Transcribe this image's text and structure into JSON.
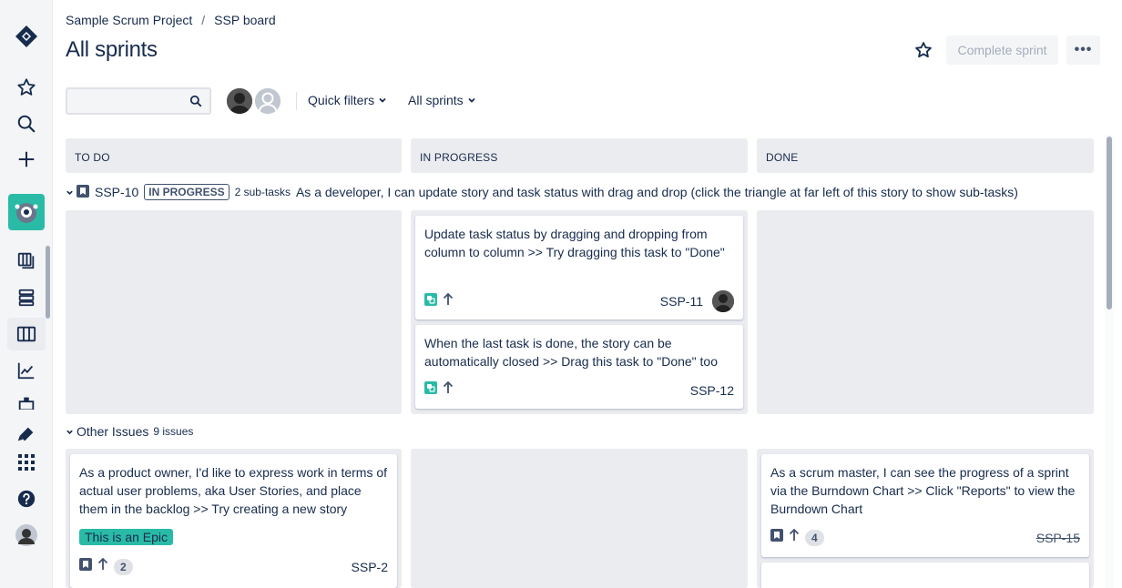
{
  "breadcrumb": {
    "project": "Sample Scrum Project",
    "separator": "/",
    "board": "SSP board"
  },
  "page": {
    "title": "All sprints"
  },
  "header": {
    "complete_sprint": "Complete sprint",
    "more": "•••"
  },
  "search": {
    "value": "",
    "placeholder": ""
  },
  "filters": {
    "quick_filters": "Quick filters",
    "all_sprints": "All sprints"
  },
  "columns": [
    "TO DO",
    "IN PROGRESS",
    "DONE"
  ],
  "lanes": {
    "story": {
      "key": "SSP-10",
      "status": "IN PROGRESS",
      "subtasks": "2 sub-tasks",
      "summary": "As a developer, I can update story and task status with drag and drop (click the triangle at far left of this story to show sub-tasks)"
    },
    "other": {
      "label": "Other Issues",
      "count": "9 issues"
    }
  },
  "cards": {
    "ssp11": {
      "summary": "Update task status by dragging and dropping from column to column >> Try dragging this task to \"Done\"",
      "key": "SSP-11"
    },
    "ssp12": {
      "summary": "When the last task is done, the story can be automatically closed >> Drag this task to \"Done\" too",
      "key": "SSP-12"
    },
    "ssp2": {
      "summary": "As a product owner, I'd like to express work in terms of actual user problems, aka User Stories, and place them in the backlog >> Try creating a new story",
      "epic": "This is an Epic",
      "points": "2",
      "key": "SSP-2"
    },
    "ssp15": {
      "summary": "As a scrum master, I can see the progress of a sprint via the Burndown Chart >> Click \"Reports\" to view the Burndown Chart",
      "points": "4",
      "key": "SSP-15"
    }
  },
  "icons": {
    "nav": [
      "jira-logo-icon",
      "star-icon",
      "search-icon",
      "create-icon",
      "project-avatar-icon",
      "backlog-icon",
      "board-icon",
      "columns-icon",
      "reports-icon",
      "releases-icon",
      "feedback-icon",
      "apps-icon",
      "help-icon",
      "profile-avatar"
    ]
  },
  "colors": {
    "accent": "#0052CC",
    "epic": "#2ABBA7",
    "project_avatar": "#2ABBA7"
  }
}
